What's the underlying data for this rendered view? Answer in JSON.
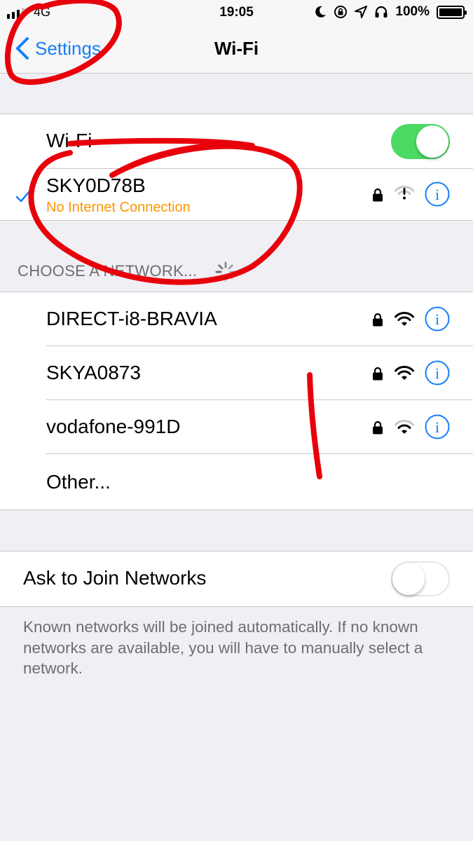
{
  "status_bar": {
    "carrier": "4G",
    "time": "19:05",
    "battery_percent": "100%",
    "signal_bars_active": 3,
    "signal_bars_total": 4,
    "icons": [
      "moon-icon",
      "rotation-lock-icon",
      "location-icon",
      "headphones-icon"
    ]
  },
  "nav": {
    "back_label": "Settings",
    "title": "Wi-Fi"
  },
  "wifi_toggle": {
    "label": "Wi-Fi",
    "on": true
  },
  "connected_network": {
    "name": "SKY0D78B",
    "status": "No Internet Connection",
    "secured": true,
    "signal": "no-internet"
  },
  "choose_network": {
    "header": "CHOOSE A NETWORK...",
    "networks": [
      {
        "name": "DIRECT-i8-BRAVIA",
        "secured": true,
        "signal_level": 3
      },
      {
        "name": "SKYA0873",
        "secured": true,
        "signal_level": 3
      },
      {
        "name": "vodafone-991D",
        "secured": true,
        "signal_level": 2
      }
    ],
    "other_label": "Other..."
  },
  "ask_to_join": {
    "label": "Ask to Join Networks",
    "on": false,
    "footer": "Known networks will be joined automatically. If no known networks are available, you will have to manually select a network."
  },
  "colors": {
    "accent": "#157efb",
    "toggle_on": "#4cd964",
    "warning": "#ff9500",
    "background": "#efeff4",
    "annotation": "#e8000b"
  }
}
